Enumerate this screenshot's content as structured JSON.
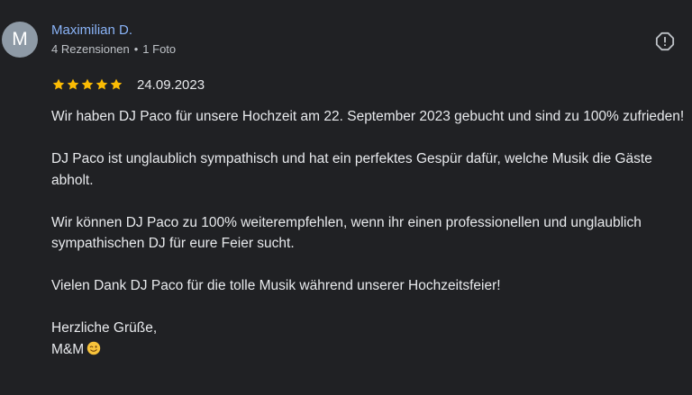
{
  "author": {
    "avatar_letter": "M",
    "name": "Maximilian D.",
    "review_count": "4 Rezensionen",
    "meta_separator": "•",
    "photo_count": "1 Foto",
    "avatar_color": "#8e9aa6",
    "name_color": "#8ab4f8"
  },
  "actions": {
    "flag_icon": "report-flag-icon"
  },
  "rating": {
    "stars": 5,
    "max_stars": 5,
    "star_color": "#fbbc04",
    "date": "24.09.2023"
  },
  "review": {
    "paragraphs": [
      "Wir haben DJ Paco für unsere Hochzeit am 22. September 2023 gebucht und sind zu 100% zufrieden!",
      "DJ Paco ist unglaublich sympathisch und hat ein perfektes Gespür dafür, welche Musik die Gäste abholt.",
      "Wir können DJ Paco zu 100% weiterempfehlen, wenn ihr einen professionellen und unglaublich sympathischen DJ für eure Feier sucht.",
      "Vielen Dank DJ Paco für die tolle Musik während unserer Hochzeitsfeier!"
    ],
    "closing_line1": "Herzliche Grüße,",
    "closing_line2": "M&M",
    "closing_emoji": "winking-face-emoji"
  },
  "colors": {
    "background": "#202124",
    "text": "#e8eaed",
    "secondary_text": "#bdc1c6"
  }
}
